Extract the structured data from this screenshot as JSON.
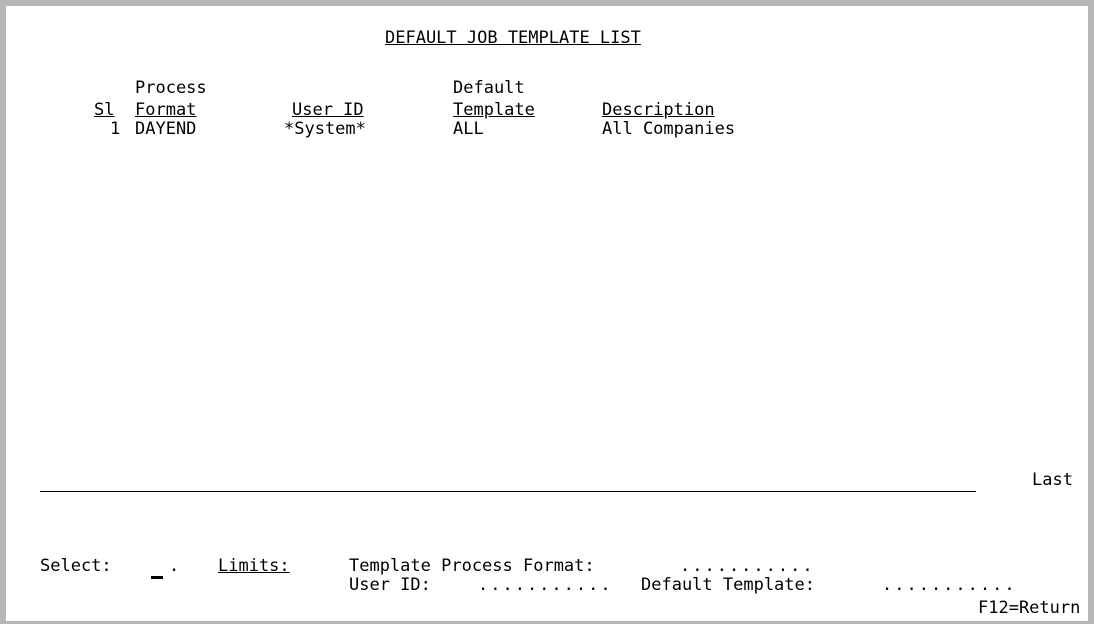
{
  "screen": {
    "title": "DEFAULT JOB TEMPLATE LIST",
    "columns": {
      "sl": "Sl",
      "process_format_line1": "Process",
      "process_format_line2": "Format",
      "user_id": "User ID",
      "default_template_line1": "Default",
      "default_template_line2": "Template",
      "description": "Description"
    },
    "rows": [
      {
        "sl": "1",
        "process_format": "DAYEND",
        "user_id": "*System*",
        "default_template": "ALL",
        "description": "All Companies"
      }
    ],
    "position_indicator": "Last",
    "select_label": "Select:",
    "select_value": "",
    "limits_label": "Limits:",
    "template_process_format_label": "Template Process Format:",
    "template_process_format_value": "...........",
    "user_id_label": "User ID:",
    "user_id_value": "...........",
    "default_template_label": "Default Template:",
    "default_template_value": "...........",
    "function_key": "F12=Return"
  },
  "colors": {
    "background": "#ffffff",
    "border": "#b7b7b7",
    "text": "#000000"
  }
}
